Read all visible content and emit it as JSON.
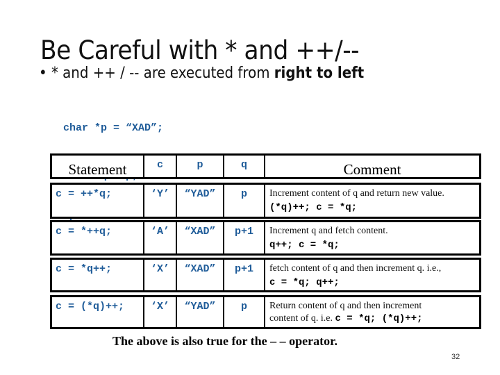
{
  "slide": {
    "title": "Be Careful with * and ++/--",
    "bullet": {
      "prefix": "• * and ++ / -- are executed from ",
      "emphasis": "right to left"
    },
    "code_lines": [
      "char *p = “XAD”;",
      "char *q = p;",
      "char c;"
    ],
    "table": {
      "headers": {
        "statement": "Statement",
        "c": "c",
        "p": "p",
        "q": "q",
        "comment": "Comment"
      },
      "rows": [
        {
          "statement": "c = ++*q;",
          "c": "‘Y’",
          "p": "“YAD”",
          "q": "p",
          "comment_text": "Increment content of q and return new value.",
          "comment_code": "(*q)++; c = *q;"
        },
        {
          "statement": "c = *++q;",
          "c": "‘A’",
          "p": "“XAD”",
          "q": "p+1",
          "comment_text": "Increment q and fetch content.",
          "comment_code": "q++; c = *q;"
        },
        {
          "statement": "c = *q++;",
          "c": "‘X’",
          "p": "“XAD”",
          "q": "p+1",
          "comment_text": "fetch content of q and then increment q. i.e.,",
          "comment_code": "c = *q; q++;"
        },
        {
          "statement": "c = (*q)++;",
          "c": "‘X’",
          "p": "“YAD”",
          "q": "p",
          "comment_text": "Return content of q and then increment",
          "comment_text2": "content of q. i.e. ",
          "comment_code": "c = *q; (*q)++;"
        }
      ]
    },
    "footer": "The above is also true for the – – operator.",
    "page_number": "32"
  },
  "colors": {
    "code_blue": "#1f5c99",
    "text": "#111111",
    "border": "#000000",
    "background": "#ffffff"
  }
}
